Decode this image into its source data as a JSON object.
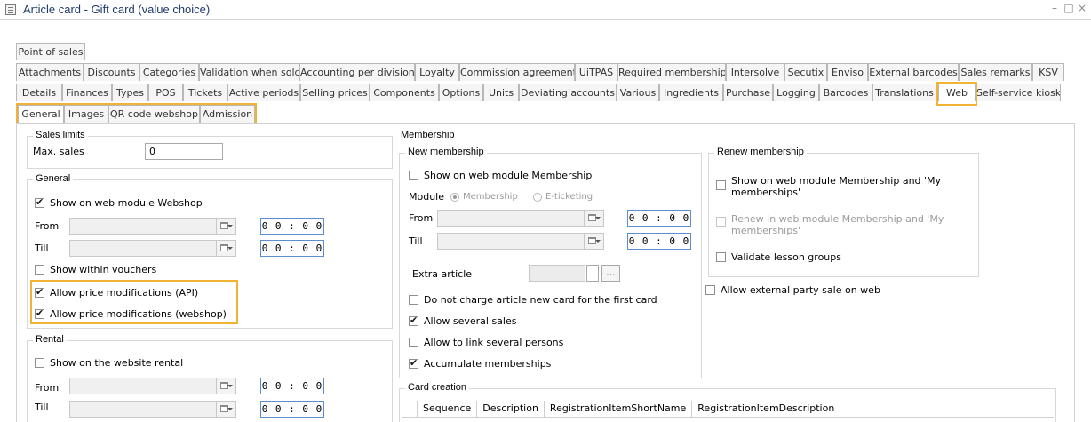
{
  "window": {
    "title": "Article card - Gift card (value choice)",
    "min_glyph": "–",
    "max_glyph": "□",
    "close_glyph": "×"
  },
  "tabs": {
    "row1": [
      "Point of sales"
    ],
    "row2": [
      "Attachments",
      "Discounts",
      "Categories",
      "Validation when sold",
      "Accounting per division",
      "Loyalty",
      "Commission agreement",
      "UiTPAS",
      "Required membership",
      "Intersolve",
      "Secutix",
      "Enviso",
      "External barcodes",
      "Sales remarks",
      "KSV"
    ],
    "row3": [
      "Details",
      "Finances",
      "Types",
      "POS",
      "Tickets",
      "Active periods",
      "Selling prices",
      "Components",
      "Options",
      "Units",
      "Deviating accounts",
      "Various",
      "Ingredients",
      "Purchase",
      "Logging",
      "Barcodes",
      "Translations",
      "Web",
      "Self-service kiosk"
    ],
    "row4": [
      "General",
      "Images",
      "QR code webshop",
      "Admission"
    ]
  },
  "sales_limits": {
    "legend": "Sales limits",
    "max_sales_label": "Max. sales",
    "max_sales_value": "0"
  },
  "general": {
    "legend": "General",
    "show_webshop": "Show on web module Webshop",
    "from_label": "From",
    "till_label": "Till",
    "from_time": "0 0 : 0 0",
    "till_time": "0 0 : 0 0",
    "show_vouchers": "Show within vouchers",
    "allow_api": "Allow price modifications (API)",
    "allow_webshop": "Allow price modifications (webshop)"
  },
  "rental": {
    "legend": "Rental",
    "show_rental": "Show on the website rental",
    "from_label": "From",
    "till_label": "Till",
    "from_time": "0 0 : 0 0",
    "till_time": "0 0 : 0 0"
  },
  "membership": {
    "legend": "Membership",
    "new": {
      "legend": "New membership",
      "show_membership": "Show on web module Membership",
      "module_label": "Module",
      "radio_membership": "Membership",
      "radio_eticketing": "E-ticketing",
      "from_label": "From",
      "till_label": "Till",
      "from_time": "0 0 : 0 0",
      "till_time": "0 0 : 0 0",
      "extra_article_label": "Extra article",
      "extra_btn": "...",
      "no_charge": "Do not charge article new card for the first card",
      "allow_several_sales": "Allow several sales",
      "allow_link_persons": "Allow to link several persons",
      "accumulate": "Accumulate memberships"
    },
    "renew": {
      "legend": "Renew membership",
      "show_renew": "Show on web module Membership and 'My memberships'",
      "renew_in": "Renew in web module Membership and 'My memberships'",
      "validate_lessons": "Validate lesson groups"
    },
    "allow_external": "Allow external party sale on web"
  },
  "card_creation": {
    "legend": "Card creation",
    "columns": [
      "Sequence",
      "Description",
      "RegistrationItemShortName",
      "RegistrationItemDescription"
    ]
  },
  "colors": {
    "highlight": "#f2b233",
    "title": "#1f3a6e",
    "time_border": "#5a8ecf"
  }
}
